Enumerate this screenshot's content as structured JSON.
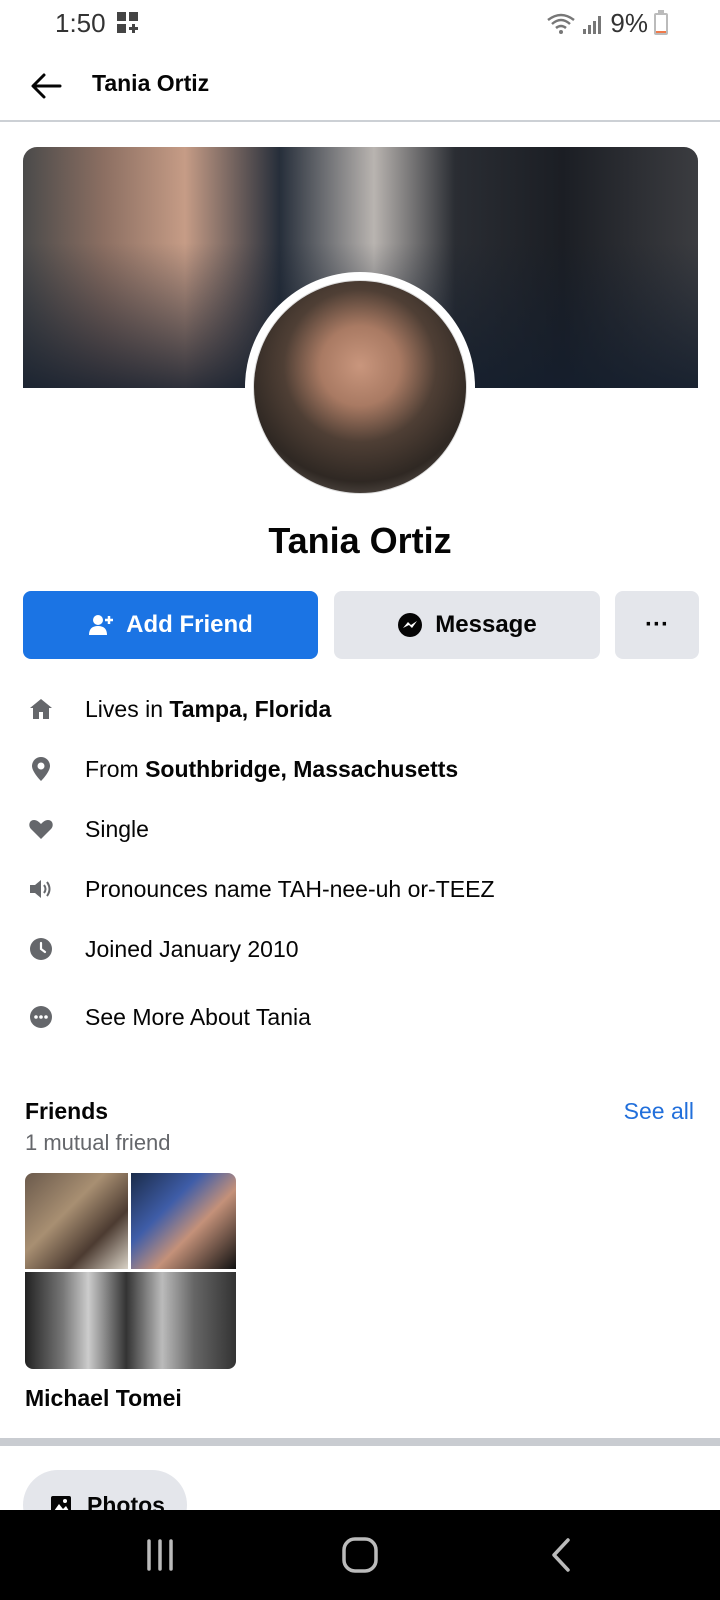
{
  "status_bar": {
    "time": "1:50",
    "battery_percent": "9%",
    "battery_level": 0.09
  },
  "header": {
    "title": "Tania Ortiz"
  },
  "profile": {
    "name": "Tania Ortiz"
  },
  "actions": {
    "add_friend": "Add Friend",
    "message": "Message",
    "more": "···"
  },
  "intro": [
    {
      "icon": "home-icon",
      "prefix": "Lives in ",
      "bold": "Tampa, Florida"
    },
    {
      "icon": "location-pin-icon",
      "prefix": "From ",
      "bold": "Southbridge, Massachusetts"
    },
    {
      "icon": "heart-icon",
      "prefix": "Single",
      "bold": ""
    },
    {
      "icon": "speaker-icon",
      "prefix": "Pronounces name TAH-nee-uh or-TEEZ",
      "bold": ""
    },
    {
      "icon": "clock-icon",
      "prefix": "Joined January 2010",
      "bold": ""
    },
    {
      "icon": "more-circle-icon",
      "prefix": "See More About Tania",
      "bold": ""
    }
  ],
  "friends": {
    "title": "Friends",
    "see_all": "See all",
    "subtitle": "1 mutual friend",
    "items": [
      {
        "name": "Michael Tomei"
      }
    ]
  },
  "photos": {
    "label": "Photos"
  },
  "colors": {
    "primary": "#1b74e4",
    "secondary_button": "#e4e6eb",
    "link": "#216fdb"
  }
}
